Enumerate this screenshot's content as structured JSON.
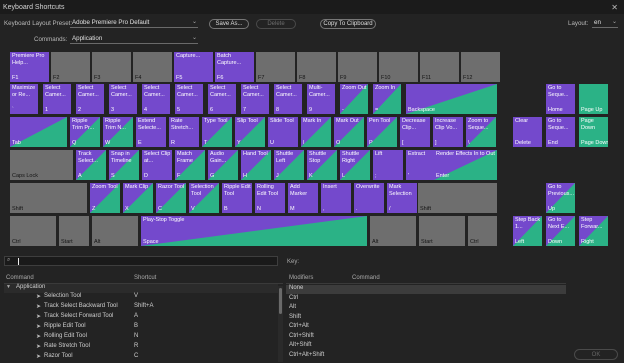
{
  "window": {
    "title": "Keyboard Shortcuts",
    "close": "✕"
  },
  "toolbar": {
    "preset_label": "Keyboard Layout Preset:",
    "preset_value": "Adobe Premiere Pro Default",
    "save_as": "Save As...",
    "delete": "Delete",
    "copy_clipboard": "Copy To Clipboard",
    "layout_label": "Layout:",
    "layout_value": "en",
    "commands_label": "Commands:",
    "commands_value": "Application"
  },
  "colors": {
    "app_shortcut": "#7449cc",
    "panel_shortcut": "#2bb286",
    "unassigned": "#6e6e6e"
  },
  "keys": [
    {
      "l": "F1",
      "c": "Premiere Pro Help...",
      "s": "p"
    },
    {
      "l": "F2",
      "c": "",
      "s": "n"
    },
    {
      "l": "F3",
      "c": "",
      "s": "n"
    },
    {
      "l": "F4",
      "c": "",
      "s": "n"
    },
    {
      "l": "F5",
      "c": "Capture...",
      "s": "p"
    },
    {
      "l": "F6",
      "c": "Batch Capture...",
      "s": "p"
    },
    {
      "l": "F7",
      "c": "",
      "s": "n"
    },
    {
      "l": "F8",
      "c": "",
      "s": "n"
    },
    {
      "l": "F9",
      "c": "",
      "s": "n"
    },
    {
      "l": "F10",
      "c": "",
      "s": "n"
    },
    {
      "l": "F11",
      "c": "",
      "s": "n"
    },
    {
      "l": "F12",
      "c": "",
      "s": "n"
    },
    {
      "l": "`",
      "c": "Maximize or Re...",
      "s": "p"
    },
    {
      "l": "1",
      "c": "Select Camer...",
      "s": "p"
    },
    {
      "l": "2",
      "c": "Select Camer...",
      "s": "p"
    },
    {
      "l": "3",
      "c": "Select Camer...",
      "s": "p"
    },
    {
      "l": "4",
      "c": "Select Camer...",
      "s": "p"
    },
    {
      "l": "5",
      "c": "Select Camer...",
      "s": "p"
    },
    {
      "l": "6",
      "c": "Select Camer...",
      "s": "p"
    },
    {
      "l": "7",
      "c": "Select Camer...",
      "s": "p"
    },
    {
      "l": "8",
      "c": "Select Camer...",
      "s": "p"
    },
    {
      "l": "9",
      "c": "Multi-Camer...",
      "s": "p"
    },
    {
      "l": "-",
      "c": "Zoom Out",
      "s": "s"
    },
    {
      "l": "=",
      "c": "Zoom In",
      "s": "s"
    },
    {
      "l": "Backspace",
      "c": "",
      "s": "s"
    },
    {
      "l": "Home",
      "c": "Go to Seque...",
      "s": "p"
    },
    {
      "l": "Page Up",
      "c": "",
      "s": "g"
    },
    {
      "l": "Tab",
      "c": "",
      "s": "s"
    },
    {
      "l": "Q",
      "c": "Ripple Trim Pr...",
      "s": "s"
    },
    {
      "l": "W",
      "c": "Ripple Trim N...",
      "s": "s"
    },
    {
      "l": "E",
      "c": "Extend Selecte...",
      "s": "p"
    },
    {
      "l": "R",
      "c": "Rate Stretch...",
      "s": "p"
    },
    {
      "l": "T",
      "c": "Type Tool",
      "s": "s"
    },
    {
      "l": "Y",
      "c": "Slip Tool",
      "s": "s"
    },
    {
      "l": "U",
      "c": "Slide Tool",
      "s": "p"
    },
    {
      "l": "I",
      "c": "Mark In",
      "s": "s"
    },
    {
      "l": "O",
      "c": "Mark Out",
      "s": "s"
    },
    {
      "l": "P",
      "c": "Pen Tool",
      "s": "s"
    },
    {
      "l": "[",
      "c": "Decrease Clip...",
      "s": "p"
    },
    {
      "l": "]",
      "c": "Increase Clip Vo...",
      "s": "p"
    },
    {
      "l": "\\",
      "c": "Zoom to Seque...",
      "s": "s"
    },
    {
      "l": "Delete",
      "c": "Clear",
      "s": "p"
    },
    {
      "l": "End",
      "c": "Go to Seque...",
      "s": "p"
    },
    {
      "l": "Page Down",
      "c": "Page Down",
      "s": "g"
    },
    {
      "l": "Caps Lock",
      "c": "",
      "s": "n"
    },
    {
      "l": "A",
      "c": "Track Select...",
      "s": "s"
    },
    {
      "l": "S",
      "c": "Snap in Timeline",
      "s": "s"
    },
    {
      "l": "D",
      "c": "Select Clip at...",
      "s": "p"
    },
    {
      "l": "F",
      "c": "Match Frame",
      "s": "s"
    },
    {
      "l": "G",
      "c": "Audio Gain...",
      "s": "s"
    },
    {
      "l": "H",
      "c": "Hand Tool",
      "s": "s"
    },
    {
      "l": "J",
      "c": "Shuttle Left",
      "s": "s"
    },
    {
      "l": "K",
      "c": "Shuttle Stop",
      "s": "s"
    },
    {
      "l": "L",
      "c": "Shuttle Right",
      "s": "s"
    },
    {
      "l": ";",
      "c": "Lift",
      "s": "p"
    },
    {
      "l": "'",
      "c": "Extract",
      "s": "p"
    },
    {
      "l": "Enter",
      "c": "Render Effects In to Out",
      "s": "s"
    },
    {
      "l": "Shift",
      "c": "",
      "s": "n"
    },
    {
      "l": "Z",
      "c": "Zoom Tool",
      "s": "s"
    },
    {
      "l": "X",
      "c": "Mark Clip",
      "s": "s"
    },
    {
      "l": "C",
      "c": "Razor Tool",
      "s": "s"
    },
    {
      "l": "V",
      "c": "Selection Tool",
      "s": "s"
    },
    {
      "l": "B",
      "c": "Ripple Edit Tool",
      "s": "p"
    },
    {
      "l": "N",
      "c": "Rolling Edit Tool",
      "s": "p"
    },
    {
      "l": "M",
      "c": "Add Marker",
      "s": "p"
    },
    {
      "l": ",",
      "c": "Insert",
      "s": "p"
    },
    {
      "l": ".",
      "c": "Overwrite",
      "s": "p"
    },
    {
      "l": "/",
      "c": "Mark Selection",
      "s": "p"
    },
    {
      "l": "Shift",
      "c": "",
      "s": "n"
    },
    {
      "l": "Up",
      "c": "Go to Previous...",
      "s": "s"
    },
    {
      "l": "Ctrl",
      "c": "",
      "s": "n"
    },
    {
      "l": "Start",
      "c": "",
      "s": "n"
    },
    {
      "l": "Alt",
      "c": "",
      "s": "n"
    },
    {
      "l": "Space",
      "c": "Play-Stop Toggle",
      "s": "s"
    },
    {
      "l": "Alt",
      "c": "",
      "s": "n"
    },
    {
      "l": "Start",
      "c": "",
      "s": "n"
    },
    {
      "l": "Ctrl",
      "c": "",
      "s": "n"
    },
    {
      "l": "Left",
      "c": "Step Back 1...",
      "s": "s"
    },
    {
      "l": "Down",
      "c": "Go to Next E...",
      "s": "s"
    },
    {
      "l": "Right",
      "c": "Step Forwar...",
      "s": "s"
    }
  ],
  "search": {
    "icon": "⌕",
    "placeholder": ""
  },
  "commands_list": {
    "col_command": "Command",
    "col_shortcut": "Shortcut",
    "group": "Application",
    "items": [
      {
        "name": "Selection Tool",
        "shortcut": "V",
        "icon": "arrow-icon"
      },
      {
        "name": "Track Select Backward Tool",
        "shortcut": "Shift+A",
        "icon": "track-back-icon"
      },
      {
        "name": "Track Select Forward Tool",
        "shortcut": "A",
        "icon": "track-fwd-icon"
      },
      {
        "name": "Ripple Edit Tool",
        "shortcut": "B",
        "icon": "ripple-icon"
      },
      {
        "name": "Rolling Edit Tool",
        "shortcut": "N",
        "icon": "rolling-icon"
      },
      {
        "name": "Rate Stretch Tool",
        "shortcut": "R",
        "icon": "rate-icon"
      },
      {
        "name": "Razor Tool",
        "shortcut": "C",
        "icon": "razor-icon"
      }
    ]
  },
  "key_panel": {
    "title": "Key:",
    "col_modifiers": "Modifiers",
    "col_command": "Command",
    "modifiers": [
      "None",
      "Ctrl",
      "Alt",
      "Shift",
      "Ctrl+Alt",
      "Ctrl+Shift",
      "Alt+Shift",
      "Ctrl+Alt+Shift"
    ]
  },
  "footer": {
    "ok": "OK"
  }
}
